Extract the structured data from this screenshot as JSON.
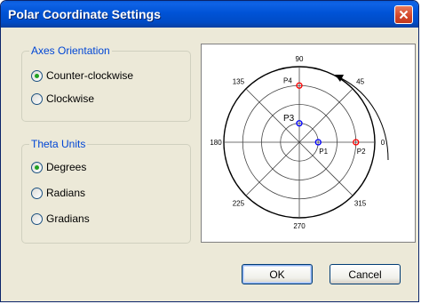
{
  "dialog": {
    "title": "Polar Coordinate Settings",
    "close_icon": "close-x-icon"
  },
  "axes_orientation": {
    "title": "Axes Orientation",
    "options": [
      {
        "label": "Counter-clockwise",
        "checked": true
      },
      {
        "label": "Clockwise",
        "checked": false
      }
    ]
  },
  "theta_units": {
    "title": "Theta Units",
    "options": [
      {
        "label": "Degrees",
        "checked": true
      },
      {
        "label": "Radians",
        "checked": false
      },
      {
        "label": "Gradians",
        "checked": false
      }
    ]
  },
  "preview": {
    "angle_labels": [
      "0",
      "45",
      "90",
      "135",
      "180",
      "225",
      "270",
      "315"
    ],
    "points": [
      {
        "label": "P1",
        "angle": 0,
        "r": 1,
        "color": "#0000ff"
      },
      {
        "label": "P2",
        "angle": 0,
        "r": 3,
        "color": "#ff0000"
      },
      {
        "label": "P3",
        "angle": 90,
        "r": 1,
        "color": "#0000ff"
      },
      {
        "label": "P4",
        "angle": 90,
        "r": 3,
        "color": "#ff0000"
      }
    ],
    "direction_arrow": "counter-clockwise-arrow-icon"
  },
  "buttons": {
    "ok": "OK",
    "cancel": "Cancel"
  },
  "colors": {
    "title_bar": "#0054e3",
    "group_title": "#0046d5",
    "radio_dot": "#21a121",
    "close_button": "#d2452a"
  }
}
